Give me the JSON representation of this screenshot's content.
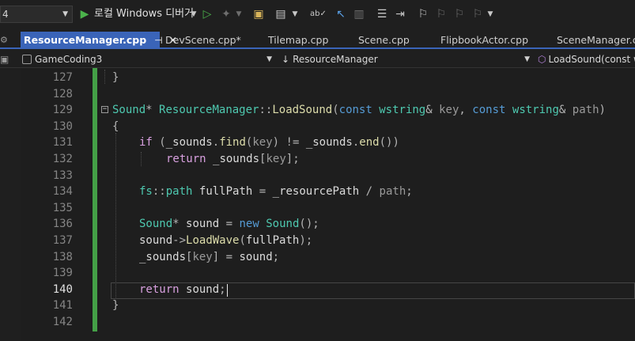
{
  "toolbar": {
    "config_value": "4",
    "debug_label": "로컬 Windows 디버거",
    "dropdown_caret": "▾"
  },
  "tabs": [
    {
      "label": "ResourceManager.cpp",
      "active": true
    },
    {
      "label": "DevScene.cpp*"
    },
    {
      "label": "Tilemap.cpp"
    },
    {
      "label": "Scene.cpp"
    },
    {
      "label": "FlipbookActor.cpp"
    },
    {
      "label": "SceneManager.cpp"
    }
  ],
  "tab_icons": {
    "pin": "⊣",
    "close": "✕"
  },
  "navbar": {
    "project": "GameCoding3",
    "scope": "ResourceManager",
    "member": "LoadSound(const w"
  },
  "editor": {
    "line_numbers": [
      "127",
      "128",
      "129",
      "130",
      "131",
      "132",
      "133",
      "134",
      "135",
      "136",
      "137",
      "138",
      "139",
      "140",
      "141",
      "142"
    ],
    "current_line": "140",
    "lines": {
      "l127": "}",
      "l129": "Sound* ResourceManager::LoadSound(const wstring& key, const wstring& path)",
      "l130": "{",
      "l131": "if (_sounds.find(key) != _sounds.end())",
      "l132": "return _sounds[key];",
      "l134": "fs::path fullPath = _resourcePath / path;",
      "l136": "Sound* sound = new Sound();",
      "l137": "sound->LoadWave(fullPath);",
      "l138": "_sounds[key] = sound;",
      "l140": "return sound;",
      "l141": "}"
    }
  },
  "colors": {
    "keyword": "#569cd6",
    "control": "#d8a0df",
    "type": "#4ec9b0",
    "function": "#dcdcaa",
    "parameter": "#9a9a9a",
    "change_bar": "#44a047",
    "active_tab": "#3a64b8"
  },
  "icons": [
    "play-icon",
    "play-outline-icon",
    "attach-icon",
    "folder-icon",
    "window-icon",
    "spellcheck-icon",
    "cursor-icon",
    "format-icon",
    "indent-icon",
    "bookmark-icon"
  ]
}
